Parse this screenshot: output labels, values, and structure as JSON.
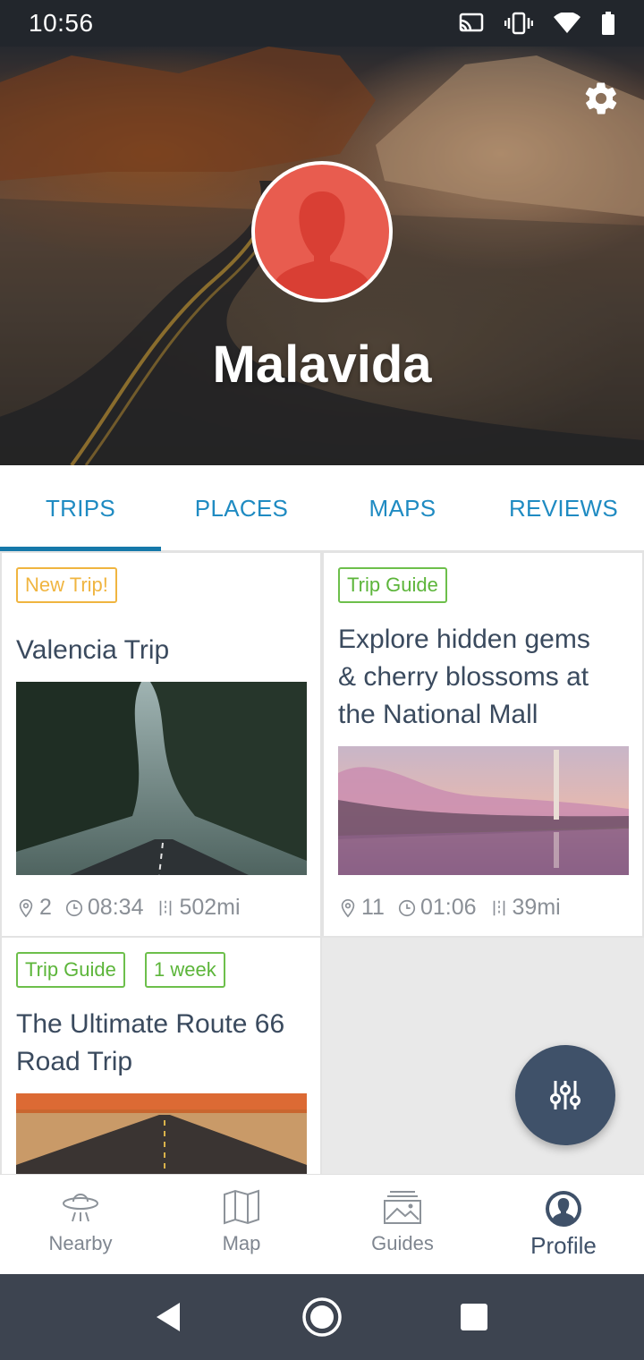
{
  "status_bar": {
    "time": "10:56",
    "icons": [
      "cast-icon",
      "vibrate-icon",
      "wifi-icon",
      "battery-icon"
    ]
  },
  "header": {
    "profile_name": "Malavida",
    "settings_icon": "gear-icon",
    "avatar_icon": "person-silhouette-icon"
  },
  "tabs": [
    {
      "label": "TRIPS",
      "active": true
    },
    {
      "label": "PLACES",
      "active": false
    },
    {
      "label": "MAPS",
      "active": false
    },
    {
      "label": "REVIEWS",
      "active": false
    }
  ],
  "cards": [
    {
      "badges": [
        "New Trip!"
      ],
      "title_lines": [
        "Valencia Trip"
      ],
      "stats": {
        "stops": "2",
        "duration": "08:34",
        "distance": "502mi"
      }
    },
    {
      "badges": [
        "Trip Guide"
      ],
      "title_lines": [
        "Explore hidden gems",
        "& cherry blossoms at",
        "the National Mall"
      ],
      "stats": {
        "stops": "11",
        "duration": "01:06",
        "distance": "39mi"
      }
    },
    {
      "badges": [
        "Trip Guide",
        "1 week"
      ],
      "title_lines": [
        "The Ultimate Route 66",
        "Road Trip"
      ]
    }
  ],
  "fab": {
    "icon": "filter-sliders-icon"
  },
  "bottom_nav": [
    {
      "label": "Nearby",
      "icon": "ufo-icon",
      "active": false
    },
    {
      "label": "Map",
      "icon": "map-icon",
      "active": false
    },
    {
      "label": "Guides",
      "icon": "guides-icon",
      "active": false
    },
    {
      "label": "Profile",
      "icon": "profile-icon",
      "active": true
    }
  ],
  "system_nav": {
    "icons": [
      "back-icon",
      "home-icon",
      "recents-icon"
    ]
  },
  "colors": {
    "tab_text": "#1f8bc2",
    "tab_indicator": "#1578a9",
    "badge_orange": "#f0b540",
    "badge_green": "#6dbf4b",
    "avatar": "#e85c4f",
    "fab": "#3f5169",
    "nav_active": "#3f5169"
  }
}
